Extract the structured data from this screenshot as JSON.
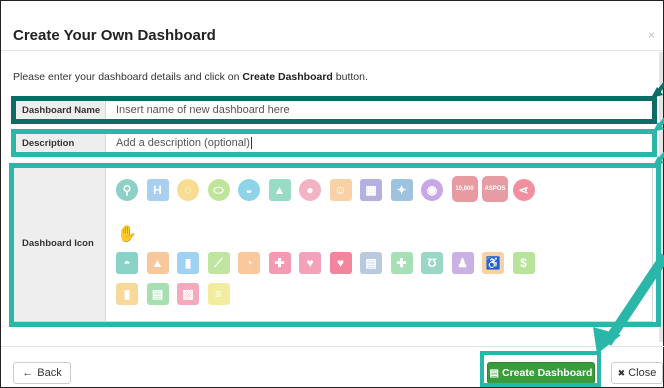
{
  "modal": {
    "title": "Create Your Own Dashboard",
    "close_glyph": "×",
    "intro_prefix": "Please enter your dashboard details and click on ",
    "intro_bold": "Create Dashboard",
    "intro_suffix": " button."
  },
  "form": {
    "name_label": "Dashboard Name",
    "name_value": "Insert name of new dashboard here",
    "description_label": "Description",
    "description_value": "Add a description (optional)",
    "icon_label": "Dashboard Icon"
  },
  "icons": {
    "row1": [
      {
        "name": "search-icon",
        "glyph": "⚲",
        "color": "#8fd0c6"
      },
      {
        "name": "dumbbell-icon",
        "glyph": "H",
        "color": "#a8cff0"
      },
      {
        "name": "speech-bubble-icon",
        "glyph": "◌",
        "color": "#f7dc92"
      },
      {
        "name": "pill-icon",
        "glyph": "⬭",
        "color": "#bfe59a"
      },
      {
        "name": "cap-icon",
        "glyph": "◒",
        "color": "#8ed3e8"
      },
      {
        "name": "mountain-icon",
        "glyph": "▲",
        "color": "#98dcc6"
      },
      {
        "name": "drop-icon",
        "glyph": "●",
        "color": "#f3b3c2"
      },
      {
        "name": "group-icon",
        "glyph": "☺",
        "color": "#f8d2a4"
      },
      {
        "name": "calendar-icon",
        "glyph": "▦",
        "color": "#b4b0e0"
      },
      {
        "name": "running-icon",
        "glyph": "✦",
        "color": "#9fc2de"
      },
      {
        "name": "clipboard-icon",
        "glyph": "◉",
        "color": "#c9a6e6"
      },
      {
        "name": "steps-badge-icon",
        "glyph": "10,000",
        "color": "#e79aa0"
      },
      {
        "name": "aspos-badge-icon",
        "glyph": "ASPOS",
        "color": "#e59ca4"
      },
      {
        "name": "share-icon",
        "glyph": "⋖",
        "color": "#f18f9f"
      },
      {
        "name": "hand-icon",
        "glyph": "✋",
        "color": "#f6e7a8"
      }
    ],
    "row2": [
      {
        "name": "speedometer-icon",
        "glyph": "◓",
        "color": "#89d2c8"
      },
      {
        "name": "area-chart-icon",
        "glyph": "▲",
        "color": "#f8c89d"
      },
      {
        "name": "bar-chart-icon",
        "glyph": "▮",
        "color": "#9ed1f2"
      },
      {
        "name": "line-chart-icon",
        "glyph": "⟋",
        "color": "#bfe5a0"
      },
      {
        "name": "pie-chart-icon",
        "glyph": "◔",
        "color": "#f9c99d"
      },
      {
        "name": "ambulance-icon",
        "glyph": "✚",
        "color": "#f49ab2"
      },
      {
        "name": "heartbeat-icon",
        "glyph": "♥",
        "color": "#f4a2b9"
      },
      {
        "name": "heart-icon",
        "glyph": "♥",
        "color": "#f2849c"
      },
      {
        "name": "hospital-icon",
        "glyph": "▤",
        "color": "#b9c9de"
      },
      {
        "name": "medkit-icon",
        "glyph": "✚",
        "color": "#a5e1b5"
      },
      {
        "name": "stethoscope-icon",
        "glyph": "Ʊ",
        "color": "#9bd7c7"
      },
      {
        "name": "user-md-icon",
        "glyph": "♟",
        "color": "#c9b1e3"
      },
      {
        "name": "wheelchair-icon",
        "glyph": "♿",
        "color": "#f8d2a6"
      },
      {
        "name": "dollar-icon",
        "glyph": "$",
        "color": "#b8e39b"
      }
    ],
    "row3": [
      {
        "name": "file-icon",
        "glyph": "▮",
        "color": "#f9d99a"
      },
      {
        "name": "file-text-icon",
        "glyph": "▤",
        "color": "#a7e0b0"
      },
      {
        "name": "file-image-icon",
        "glyph": "▨",
        "color": "#f5a9bd"
      },
      {
        "name": "file-lines-icon",
        "glyph": "≡",
        "color": "#f1ec9e"
      }
    ]
  },
  "footer": {
    "back_label": "Back",
    "back_glyph": "←",
    "create_label": "Create Dashboard",
    "create_glyph": "▤",
    "close_label": "Close",
    "close_glyph": "✖"
  },
  "colors": {
    "highlight_teal": "#2bb6aa",
    "highlight_dark": "#0d6d66",
    "primary_green": "#3a9b3c"
  }
}
